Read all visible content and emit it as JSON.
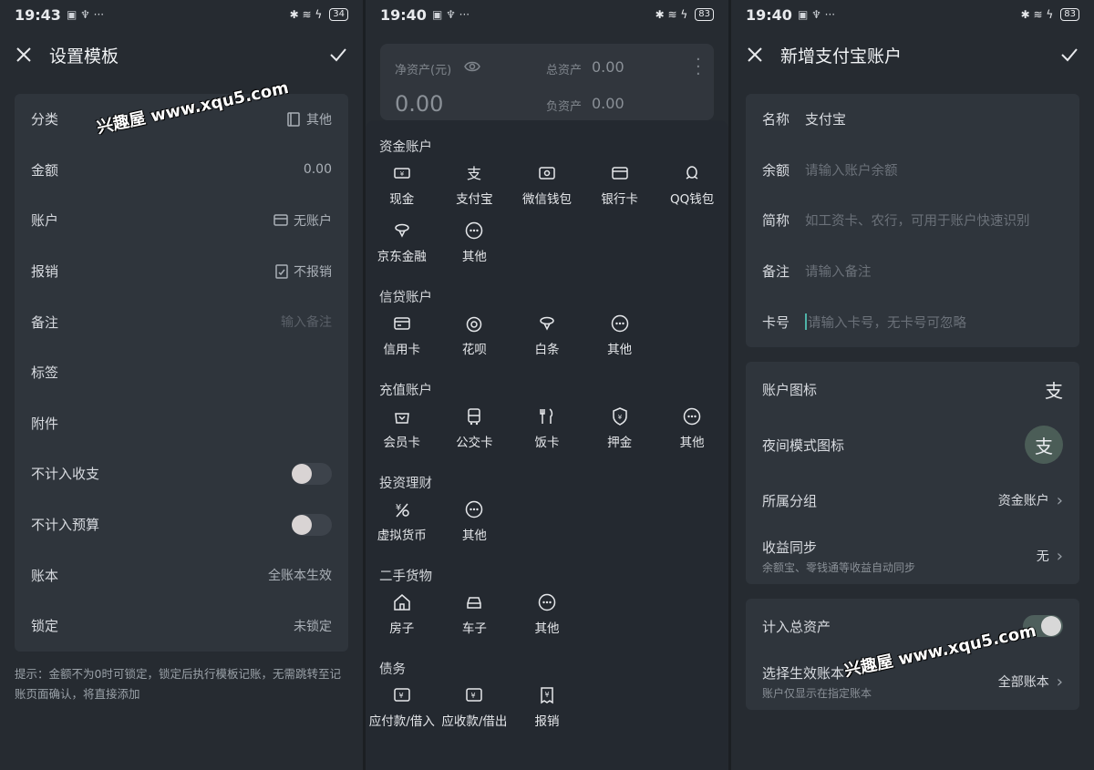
{
  "status": [
    {
      "time": "19:43",
      "battery": "34"
    },
    {
      "time": "19:40",
      "battery": "83"
    },
    {
      "time": "19:40",
      "battery": "83"
    }
  ],
  "panel1": {
    "title": "设置模板",
    "rows": [
      {
        "label": "分类",
        "value": "其他"
      },
      {
        "label": "金额",
        "value": "0.00"
      },
      {
        "label": "账户",
        "value": "无账户"
      },
      {
        "label": "报销",
        "value": "不报销"
      },
      {
        "label": "备注",
        "placeholder": "输入备注"
      },
      {
        "label": "标签"
      },
      {
        "label": "附件"
      },
      {
        "label": "不计入收支",
        "toggle": false
      },
      {
        "label": "不计入预算",
        "toggle": false
      },
      {
        "label": "账本",
        "value": "全账本生效"
      },
      {
        "label": "锁定",
        "value": "未锁定"
      }
    ],
    "hint": "提示：金额不为0时可锁定，锁定后执行模板记账，无需跳转至记账页面确认，将直接添加",
    "watermark": "兴趣屋 www.xqu5.com"
  },
  "panel2": {
    "header": {
      "net_label": "净资产(元)",
      "net_value": "0.00",
      "total_label": "总资产",
      "total_value": "0.00",
      "debt_label": "负资产",
      "debt_value": "0.00"
    },
    "sections": [
      {
        "title": "资金账户",
        "items": [
          "现金",
          "支付宝",
          "微信钱包",
          "银行卡",
          "QQ钱包",
          "京东金融",
          "其他"
        ]
      },
      {
        "title": "信贷账户",
        "items": [
          "信用卡",
          "花呗",
          "白条",
          "其他"
        ]
      },
      {
        "title": "充值账户",
        "items": [
          "会员卡",
          "公交卡",
          "饭卡",
          "押金",
          "其他"
        ]
      },
      {
        "title": "投资理财",
        "items": [
          "虚拟货币",
          "其他"
        ]
      },
      {
        "title": "二手货物",
        "items": [
          "房子",
          "车子",
          "其他"
        ]
      },
      {
        "title": "债务",
        "items": [
          "应付款/借入",
          "应收款/借出",
          "报销"
        ]
      }
    ]
  },
  "panel3": {
    "title": "新增支付宝账户",
    "form": [
      {
        "label": "名称",
        "value": "支付宝"
      },
      {
        "label": "余额",
        "placeholder": "请输入账户余额"
      },
      {
        "label": "简称",
        "placeholder": "如工资卡、农行，可用于账户快速识别"
      },
      {
        "label": "备注",
        "placeholder": "请输入备注"
      },
      {
        "label": "卡号",
        "placeholder": "请输入卡号，无卡号可忽略"
      }
    ],
    "icon_label": "账户图标",
    "icon_glyph": "支",
    "night_label": "夜间模式图标",
    "group_label": "所属分组",
    "group_value": "资金账户",
    "sync_label": "收益同步",
    "sync_sub": "余额宝、零钱通等收益自动同步",
    "sync_value": "无",
    "total_label": "计入总资产",
    "total_toggle": true,
    "book_label": "选择生效账本",
    "book_sub": "账户仅显示在指定账本",
    "book_value": "全部账本",
    "watermark": "兴趣屋 www.xqu5.com"
  }
}
